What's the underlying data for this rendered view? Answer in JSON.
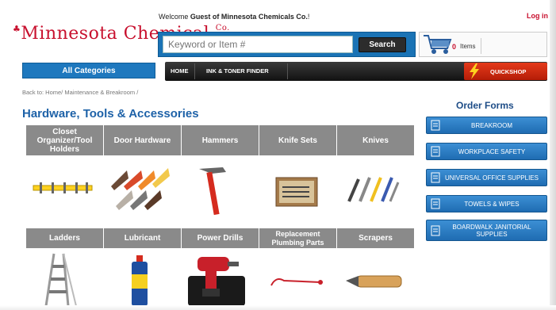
{
  "header": {
    "welcome_prefix": "Welcome ",
    "welcome_name": "Guest of Minnesota Chemicals Co.",
    "welcome_suffix": "!",
    "login_label": "Log in",
    "logo_text": "Minnesota Chemical",
    "logo_superscript": "Co."
  },
  "search": {
    "placeholder": "Keyword or Item #",
    "button_label": "Search"
  },
  "cart": {
    "count": "0",
    "items_label": "Items"
  },
  "categories_button": "All Categories",
  "nav": {
    "items": [
      "HOME",
      "INK & TONER FINDER"
    ],
    "quickshop_label": "QUICKSHOP"
  },
  "breadcrumb": "Back to: Home/ Maintenance & Breakroom /",
  "page_title": "Hardware, Tools & Accessories",
  "tiles_row1": [
    {
      "label": "Closet Organizer/Tool Holders",
      "image": "tool-holder-image"
    },
    {
      "label": "Door Hardware",
      "image": "door-stops-image"
    },
    {
      "label": "Hammers",
      "image": "hammer-image"
    },
    {
      "label": "Knife Sets",
      "image": "knife-set-image"
    },
    {
      "label": "Knives",
      "image": "knives-image"
    }
  ],
  "tiles_row2": [
    {
      "label": "Ladders",
      "image": "step-ladder-image"
    },
    {
      "label": "Lubricant",
      "image": "lubricant-can-image"
    },
    {
      "label": "Power Drills",
      "image": "power-drill-image"
    },
    {
      "label": "Replacement Plumbing Parts",
      "image": "plumbing-part-image"
    },
    {
      "label": "Scrapers",
      "image": "scraper-image"
    }
  ],
  "order_forms": {
    "title": "Order Forms",
    "items": [
      "BREAKROOM",
      "WORKPLACE SAFETY",
      "UNIVERSAL OFFICE SUPPLIES",
      "TOWELS & WIPES",
      "BOARDWALK JANITORIAL SUPPLIES"
    ]
  },
  "colors": {
    "brand_red": "#c8102e",
    "accent_blue": "#1e78be",
    "heading_blue": "#1e62a8",
    "tile_gray": "#8a8a8a",
    "nav_black": "#1a1a1a",
    "quickshop_red": "#d42e12"
  }
}
